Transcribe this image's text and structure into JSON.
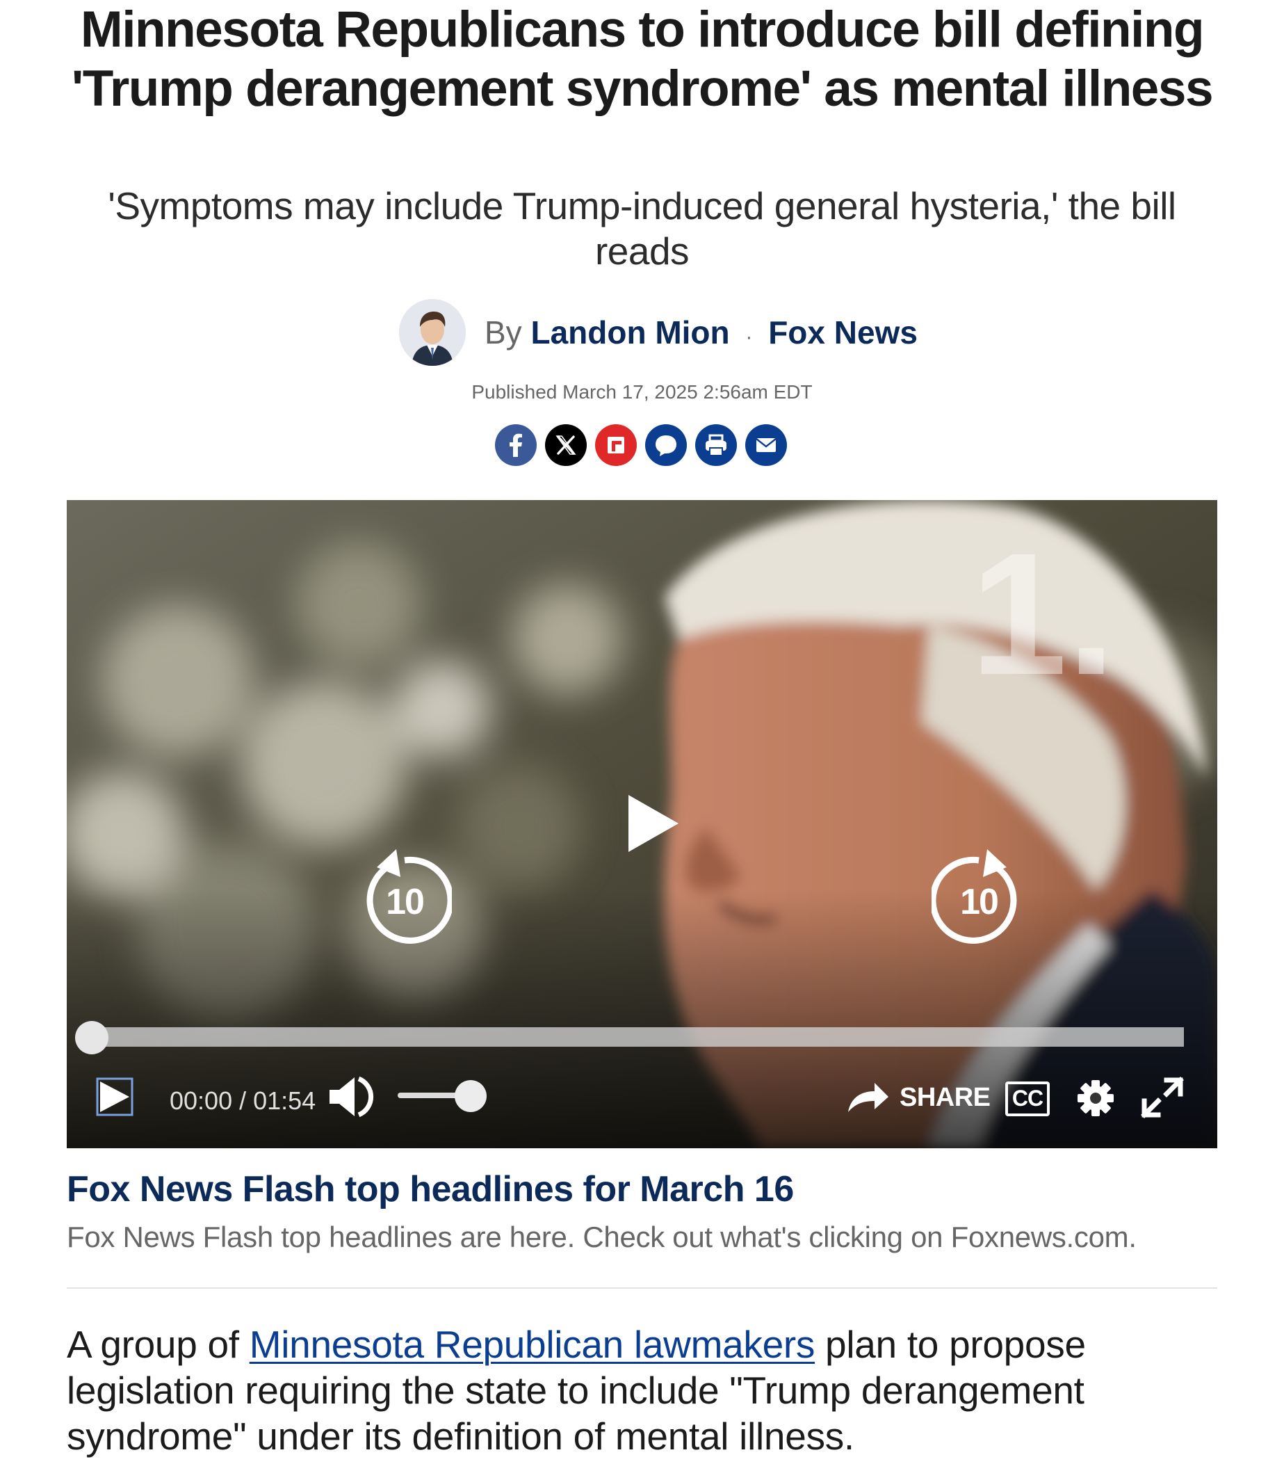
{
  "article": {
    "headline": "Minnesota Republicans to introduce bill defining 'Trump derangement syndrome' as mental illness",
    "subheadline": "'Symptoms may include Trump-induced general hysteria,' the bill reads",
    "byline": {
      "prefix": "By",
      "author": "Landon Mion",
      "separator": "·",
      "outlet": "Fox News"
    },
    "published": "Published March 17, 2025 2:56am EDT"
  },
  "share_bar": {
    "buttons": [
      {
        "icon": "facebook-icon",
        "color": "#3b5998"
      },
      {
        "icon": "x-icon",
        "color": "#000000"
      },
      {
        "icon": "flipboard-icon",
        "color": "#e12828"
      },
      {
        "icon": "comment-icon",
        "color": "#0b3d91"
      },
      {
        "icon": "print-icon",
        "color": "#0b3d91"
      },
      {
        "icon": "email-icon",
        "color": "#0b3d91"
      }
    ]
  },
  "video": {
    "overlay_number": "1.",
    "rewind_label": "10",
    "forward_label": "10",
    "time": "00:00 / 01:54",
    "progress": 0,
    "volume": 0.8,
    "share_label": "SHARE",
    "cc_label": "CC"
  },
  "caption": {
    "title": "Fox News Flash top headlines for March 16",
    "text": "Fox News Flash top headlines are here. Check out what's clicking on Foxnews.com."
  },
  "body": {
    "lead_prefix": "A group of ",
    "lead_link": "Minnesota Republican lawmakers",
    "lead_suffix": " plan to propose legislation requiring the state to include \"Trump derangement syndrome\" under its definition of mental illness."
  },
  "colors": {
    "brand_navy": "#0b2a5a",
    "link_blue": "#0b3d91"
  }
}
